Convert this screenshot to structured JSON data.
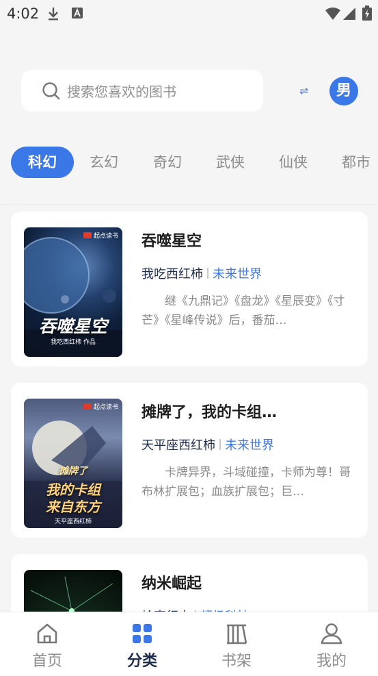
{
  "status_bar": {
    "time": "4:02"
  },
  "search": {
    "placeholder": "搜索您喜欢的图书"
  },
  "header": {
    "swap_symbol": "⇌",
    "gender_label": "男"
  },
  "tabs": [
    {
      "label": "科幻",
      "active": true
    },
    {
      "label": "玄幻",
      "active": false
    },
    {
      "label": "奇幻",
      "active": false
    },
    {
      "label": "武侠",
      "active": false
    },
    {
      "label": "仙侠",
      "active": false
    },
    {
      "label": "都市",
      "active": false
    }
  ],
  "books": [
    {
      "title": "吞噬星空",
      "author": "我吃西红柿",
      "genre": "未来世界",
      "description": "继《九鼎记》《盘龙》《星辰变》《寸芒》《星峰传说》后，番茄…",
      "cover_brand": "起点读书",
      "cover_title": "吞噬星空",
      "cover_author": "我吃西红柿 作品"
    },
    {
      "title": "摊牌了，我的卡组…",
      "author": "天平座西红柿",
      "genre": "未来世界",
      "description": "卡牌异界，斗域碰撞，卡师为尊！哥布林扩展包；血族扩展包；巨…",
      "cover_brand": "起点读书",
      "cover_title_line1": "摊牌了",
      "cover_title_line2": "我的卡组",
      "cover_title_line3": "来自东方",
      "cover_author": "天平座西红柿"
    },
    {
      "title": "纳米崛起",
      "author": "岭南行人",
      "genre": "超级科技"
    }
  ],
  "bottom_nav": [
    {
      "label": "首页",
      "icon": "home-icon",
      "active": false
    },
    {
      "label": "分类",
      "icon": "category-icon",
      "active": true
    },
    {
      "label": "书架",
      "icon": "bookshelf-icon",
      "active": false
    },
    {
      "label": "我的",
      "icon": "profile-icon",
      "active": false
    }
  ],
  "colors": {
    "accent": "#3b78e7",
    "nav_active": "#1f2d4d"
  }
}
